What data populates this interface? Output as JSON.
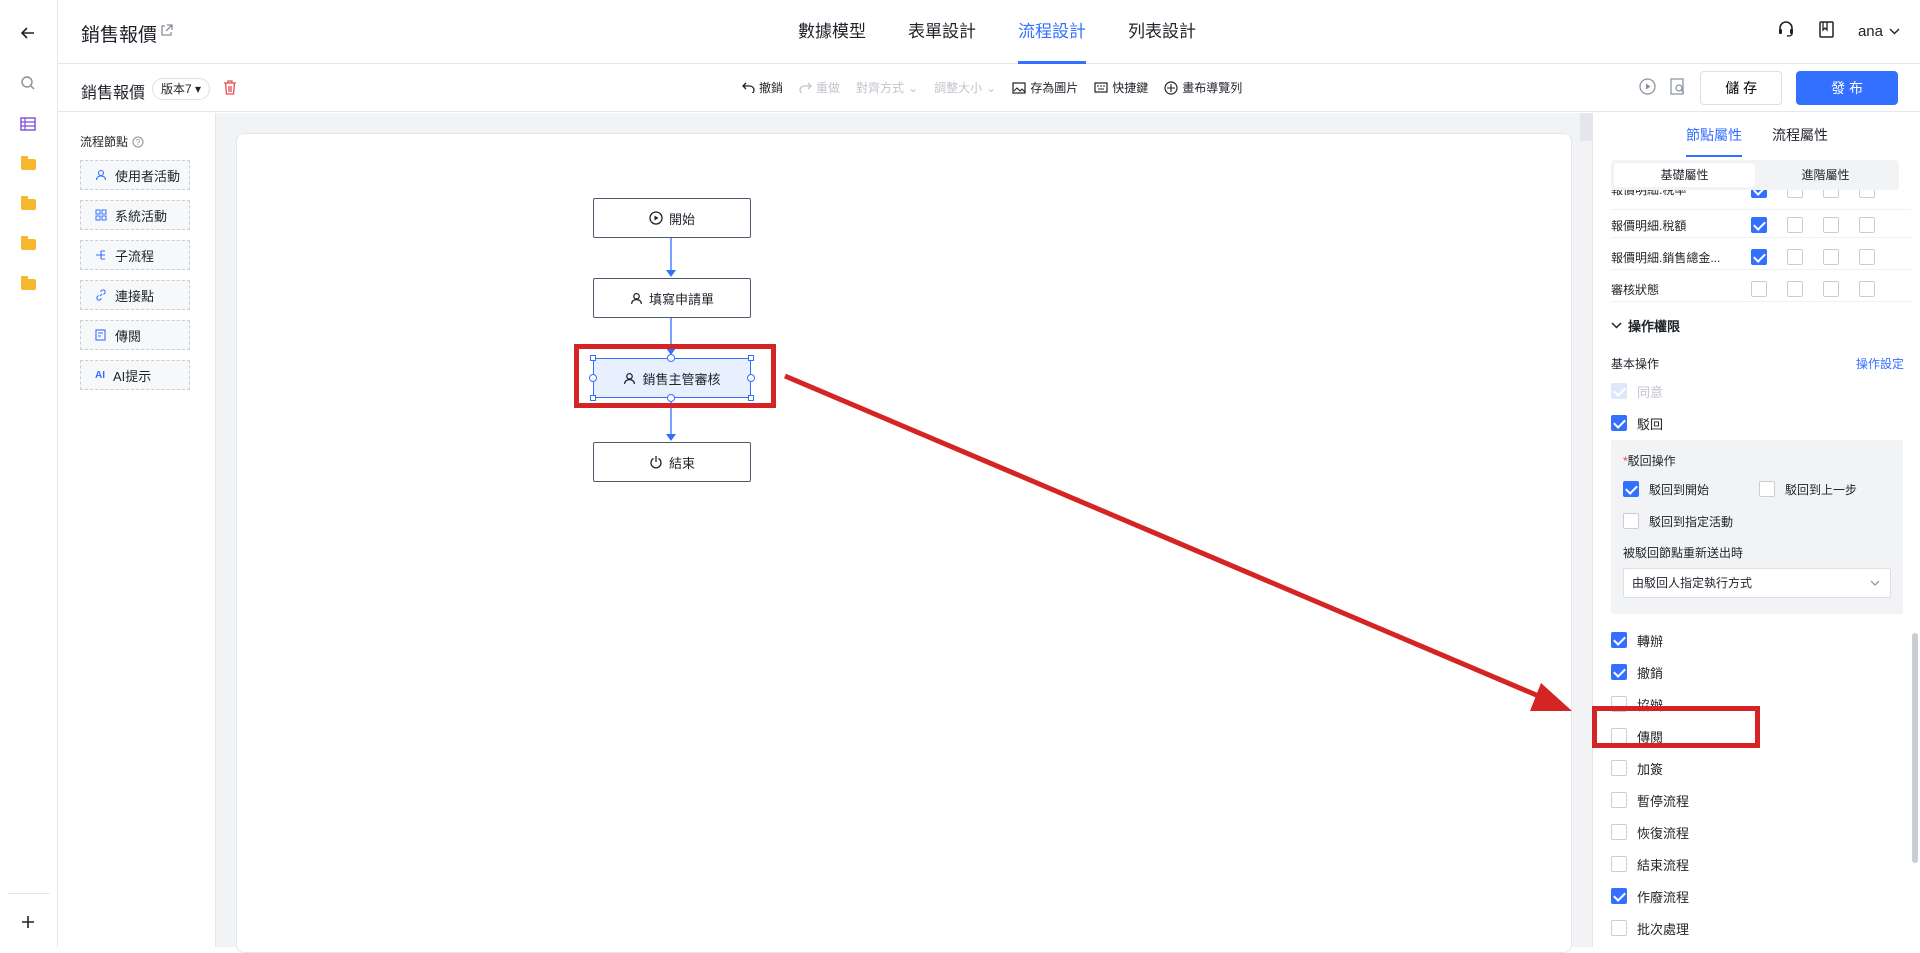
{
  "app": {
    "title": "銷售報價",
    "tabs": [
      "數據模型",
      "表單設計",
      "流程設計",
      "列表設計"
    ],
    "active_tab": "流程設計",
    "user": "ana"
  },
  "toolbar": {
    "form_name": "銷售報價",
    "version": "版本7",
    "tools": {
      "undo": "撤銷",
      "redo": "重做",
      "align": "對齊方式",
      "resize": "調整大小",
      "save_image": "存為圖片",
      "shortcuts": "快捷鍵",
      "canvas_nav": "畫布導覽列"
    },
    "save_label": "儲 存",
    "publish_label": "發 布"
  },
  "palette": {
    "title": "流程節點",
    "items": [
      "使用者活動",
      "系統活動",
      "子流程",
      "連接點",
      "傳閱",
      "AI提示"
    ]
  },
  "flow": {
    "nodes": [
      "開始",
      "填寫申請單",
      "銷售主管審核",
      "結束"
    ],
    "selected": "銷售主管審核"
  },
  "panel": {
    "tabs": [
      "節點屬性",
      "流程屬性"
    ],
    "active_tab": "節點屬性",
    "subtabs": [
      "基礎屬性",
      "進階屬性"
    ],
    "active_subtab": "基礎屬性",
    "field_rows": [
      {
        "label": "報價明細.稅率",
        "checks": [
          true,
          false,
          false,
          false
        ]
      },
      {
        "label": "報價明細.稅額",
        "checks": [
          true,
          false,
          false,
          false
        ]
      },
      {
        "label": "報價明細.銷售總金...",
        "checks": [
          true,
          false,
          false,
          false
        ]
      },
      {
        "label": "審核狀態",
        "checks": [
          false,
          false,
          false,
          false
        ]
      }
    ],
    "section_title": "操作權限",
    "basic_ops_label": "基本操作",
    "ops_settings_link": "操作設定",
    "agree": {
      "label": "同意",
      "checked": true,
      "disabled": true
    },
    "reject": {
      "label": "駁回",
      "checked": true
    },
    "reject_ops": {
      "title": "駁回操作",
      "required_mark": "*",
      "options": [
        {
          "label": "駁回到開始",
          "checked": true
        },
        {
          "label": "駁回到上一步",
          "checked": false
        },
        {
          "label": "駁回到指定活動",
          "checked": false
        }
      ],
      "resend_label": "被駁回節點重新送出時",
      "resend_value": "由駁回人指定執行方式"
    },
    "ops": [
      {
        "label": "轉辦",
        "checked": true
      },
      {
        "label": "撤銷",
        "checked": true
      },
      {
        "label": "協辦",
        "checked": false
      },
      {
        "label": "傳閱",
        "checked": false
      },
      {
        "label": "加簽",
        "checked": false
      },
      {
        "label": "暫停流程",
        "checked": false
      },
      {
        "label": "恢復流程",
        "checked": false
      },
      {
        "label": "結束流程",
        "checked": false
      },
      {
        "label": "作廢流程",
        "checked": true
      },
      {
        "label": "批次處理",
        "checked": false
      }
    ]
  },
  "colors": {
    "accent": "#3370ff",
    "highlight": "#d52424"
  }
}
